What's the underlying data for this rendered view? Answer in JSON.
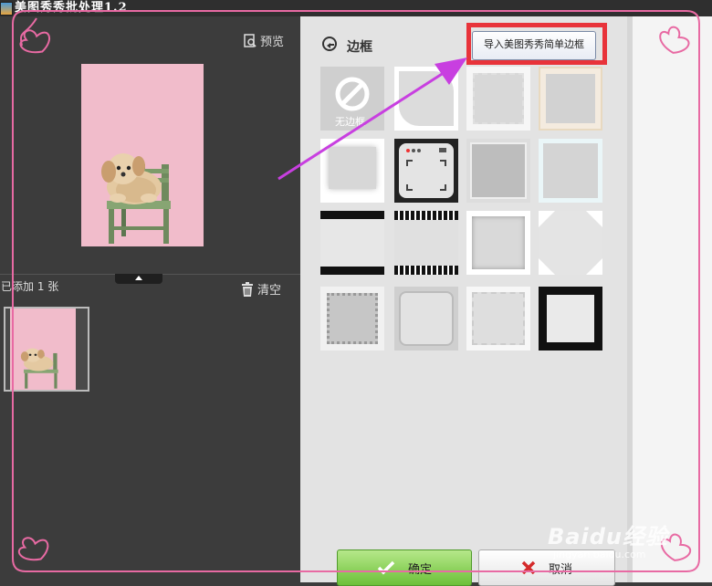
{
  "window": {
    "title": "美图秀秀批处理1.2"
  },
  "left_panel": {
    "preview_label": "预览",
    "added_label": "已添加 1 张",
    "clear_label": "清空"
  },
  "border_panel": {
    "title": "边框",
    "import_button": "导入美图秀秀简单边框",
    "no_border_label": "无边框"
  },
  "footer": {
    "confirm_label": "确定",
    "cancel_label": "取消"
  },
  "watermark": {
    "logo": "Baidu经验",
    "url": "jingyan.baidu.com"
  },
  "colors": {
    "highlight": "#e8333a",
    "arrow": "#c83fe0",
    "deco_border": "#e86aa3",
    "confirm": "#6cc039",
    "cancel_x": "#d42a2a"
  }
}
